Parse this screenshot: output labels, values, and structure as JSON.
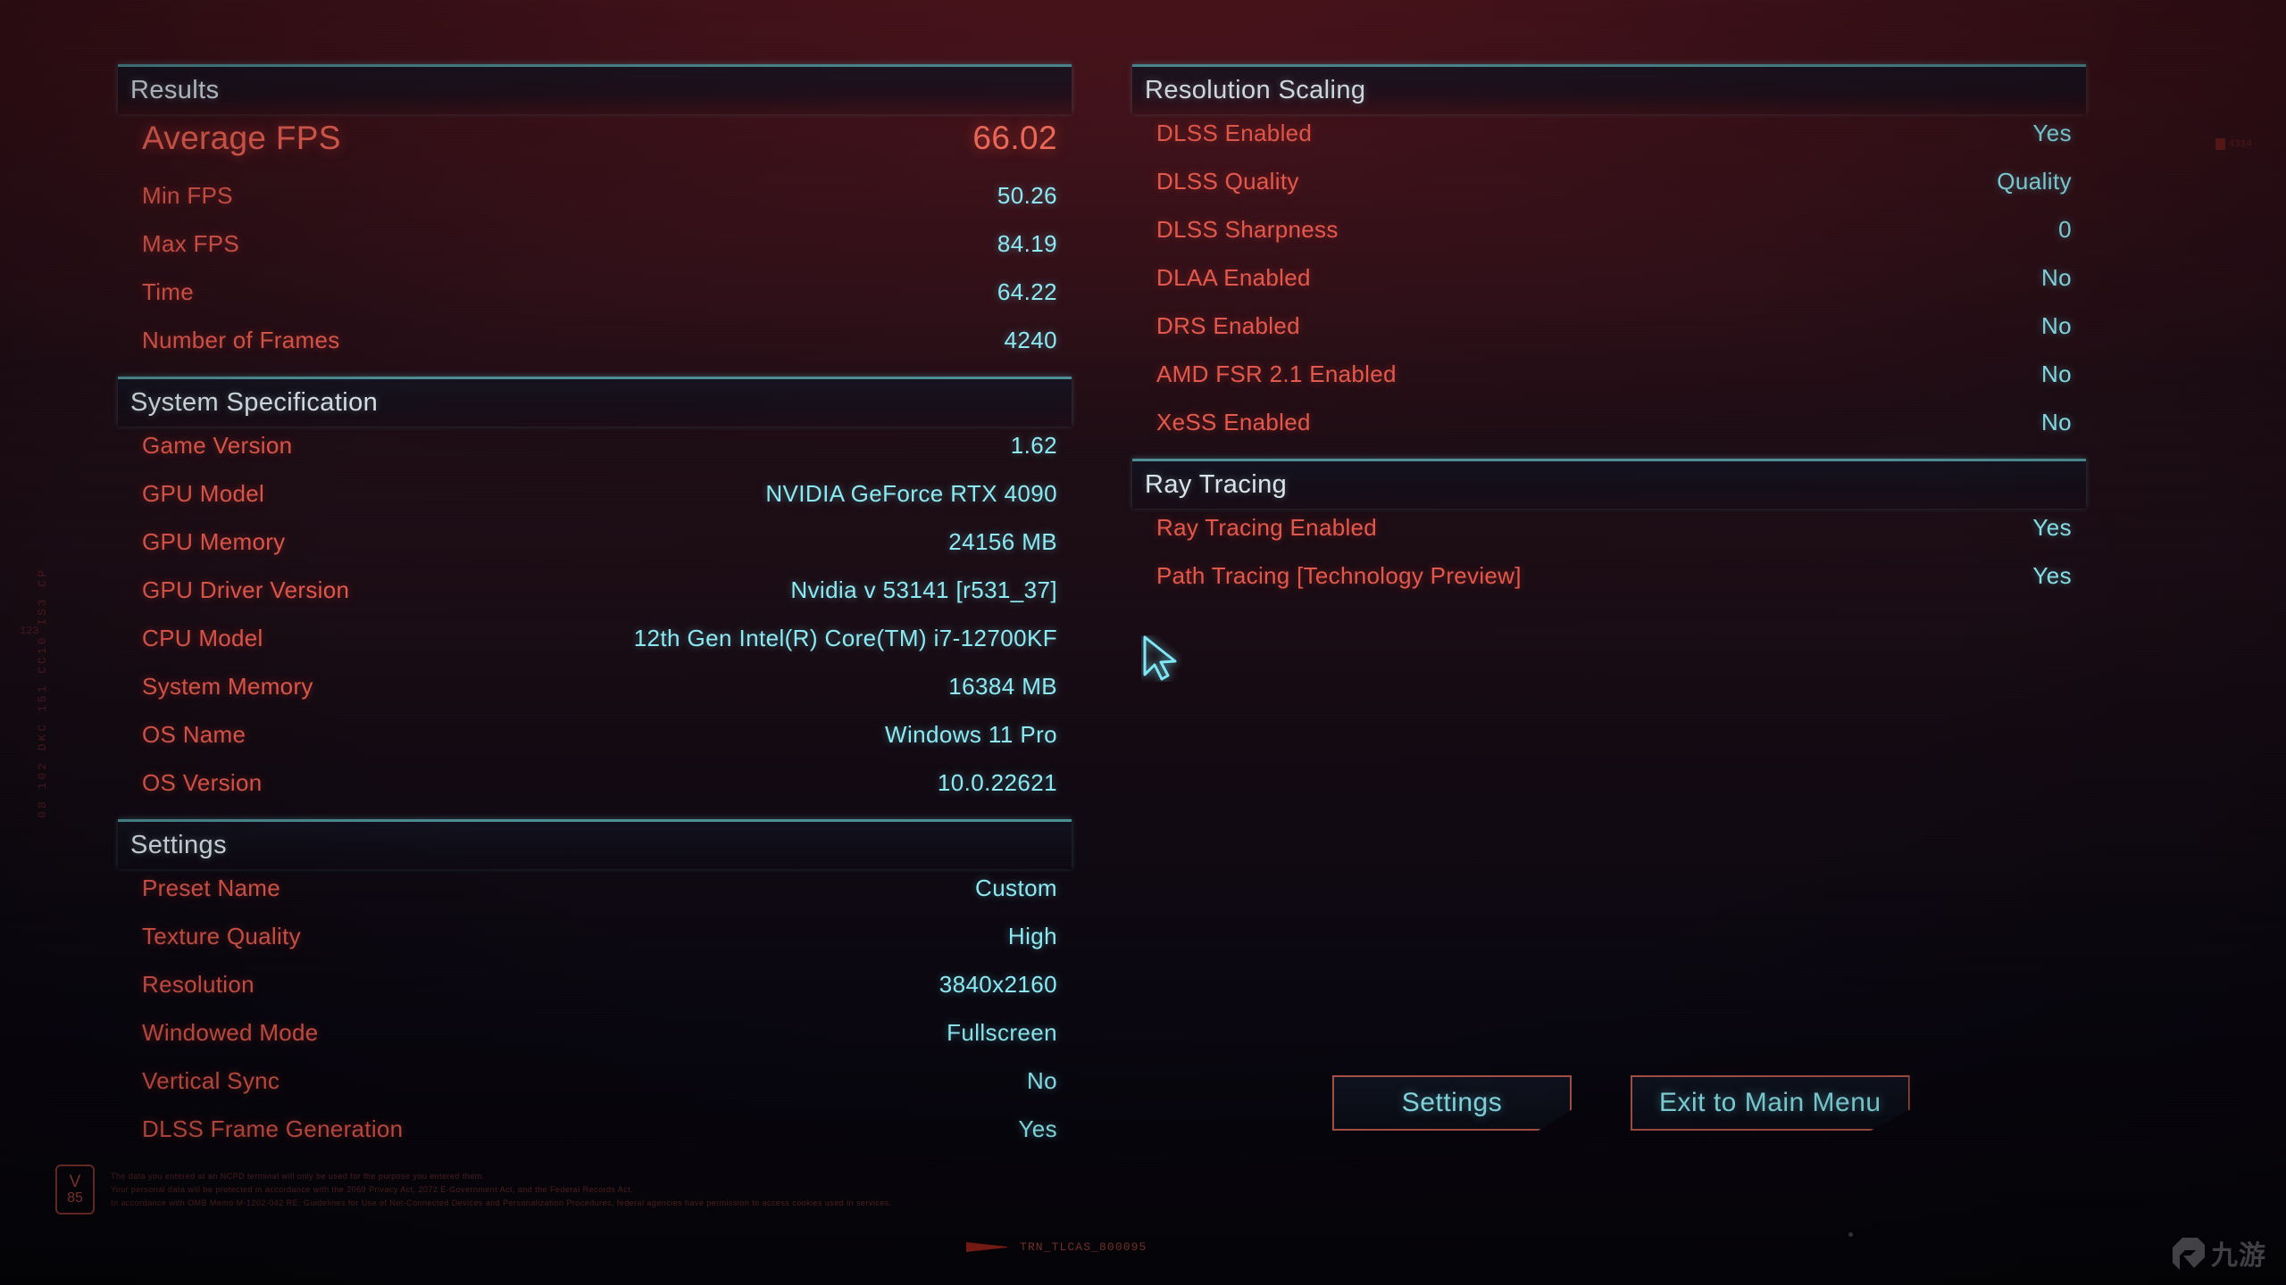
{
  "colors": {
    "label": "#e2594c",
    "value": "#8de9f2",
    "header_text": "#d9e4ea",
    "header_rule": "#4d8e95",
    "button_border": "#b5564b",
    "hero_label": "#ee6254",
    "hero_value": "#ef6a58"
  },
  "left_column": {
    "sections": [
      {
        "title": "Results",
        "rows": [
          {
            "label": "Average FPS",
            "value": "66.02",
            "hero": true
          },
          {
            "label": "Min FPS",
            "value": "50.26"
          },
          {
            "label": "Max FPS",
            "value": "84.19"
          },
          {
            "label": "Time",
            "value": "64.22"
          },
          {
            "label": "Number of Frames",
            "value": "4240"
          }
        ]
      },
      {
        "title": "System Specification",
        "rows": [
          {
            "label": "Game Version",
            "value": "1.62"
          },
          {
            "label": "GPU Model",
            "value": "NVIDIA GeForce RTX 4090"
          },
          {
            "label": "GPU Memory",
            "value": "24156 MB"
          },
          {
            "label": "GPU Driver Version",
            "value": "Nvidia v 53141 [r531_37]"
          },
          {
            "label": "CPU Model",
            "value": "12th Gen Intel(R) Core(TM) i7-12700KF"
          },
          {
            "label": "System Memory",
            "value": "16384 MB"
          },
          {
            "label": "OS Name",
            "value": "Windows 11 Pro"
          },
          {
            "label": "OS Version",
            "value": "10.0.22621"
          }
        ]
      },
      {
        "title": "Settings",
        "rows": [
          {
            "label": "Preset Name",
            "value": "Custom"
          },
          {
            "label": "Texture Quality",
            "value": "High"
          },
          {
            "label": "Resolution",
            "value": "3840x2160"
          },
          {
            "label": "Windowed Mode",
            "value": "Fullscreen"
          },
          {
            "label": "Vertical Sync",
            "value": "No"
          },
          {
            "label": "DLSS Frame Generation",
            "value": "Yes"
          }
        ]
      }
    ]
  },
  "right_column": {
    "sections": [
      {
        "title": "Resolution Scaling",
        "rows": [
          {
            "label": "DLSS Enabled",
            "value": "Yes"
          },
          {
            "label": "DLSS Quality",
            "value": "Quality"
          },
          {
            "label": "DLSS Sharpness",
            "value": "0"
          },
          {
            "label": "DLAA Enabled",
            "value": "No"
          },
          {
            "label": "DRS Enabled",
            "value": "No"
          },
          {
            "label": "AMD FSR 2.1 Enabled",
            "value": "No"
          },
          {
            "label": "XeSS Enabled",
            "value": "No"
          }
        ]
      },
      {
        "title": "Ray Tracing",
        "rows": [
          {
            "label": "Ray Tracing Enabled",
            "value": "Yes"
          },
          {
            "label": "Path Tracing [Technology Preview]",
            "value": "Yes"
          }
        ]
      }
    ]
  },
  "buttons": [
    {
      "label": "Settings",
      "name": "settings-button"
    },
    {
      "label": "Exit to Main Menu",
      "name": "exit-to-main-menu-button"
    }
  ],
  "footer": {
    "version_letter": "V",
    "version_number": "85",
    "legal_lines": [
      "The data you entered at an NCPD terminal will only be used for the purpose you entered them.",
      "Your personal data will be protected in accordance with the 2069 Privacy Act, 2072 E-Government Act, and the Federal Records Act.",
      "In accordance with OMB Memo M-1202-042 RE: Guidelines for Use of Net-Connected Devices and Personalization Procedures, federal agencies have permission to access cookies used in services."
    ],
    "bottom_tag": "TRN_TLCAS_800095",
    "edge_ticker": "08 102 DKC 151 CC10 IS3 CP",
    "edge_ticker_number": "123",
    "corner_mark_text": "4314",
    "watermark_text": "九游"
  }
}
